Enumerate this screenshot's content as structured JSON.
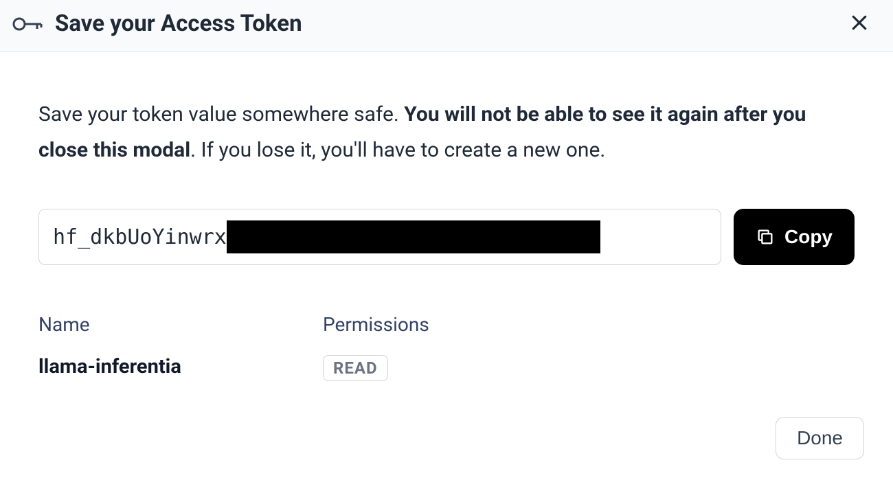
{
  "header": {
    "title": "Save your Access Token"
  },
  "instruction": {
    "part1": "Save your token value somewhere safe. ",
    "bold": "You will not be able to see it again after you close this modal",
    "part2": ". If you lose it, you'll have to create a new one."
  },
  "token": {
    "visible_prefix": "hf_dkbUoYinwrx"
  },
  "buttons": {
    "copy": "Copy",
    "done": "Done"
  },
  "meta": {
    "name_label": "Name",
    "name_value": "llama-inferentia",
    "permissions_label": "Permissions",
    "permissions_value": "READ"
  }
}
